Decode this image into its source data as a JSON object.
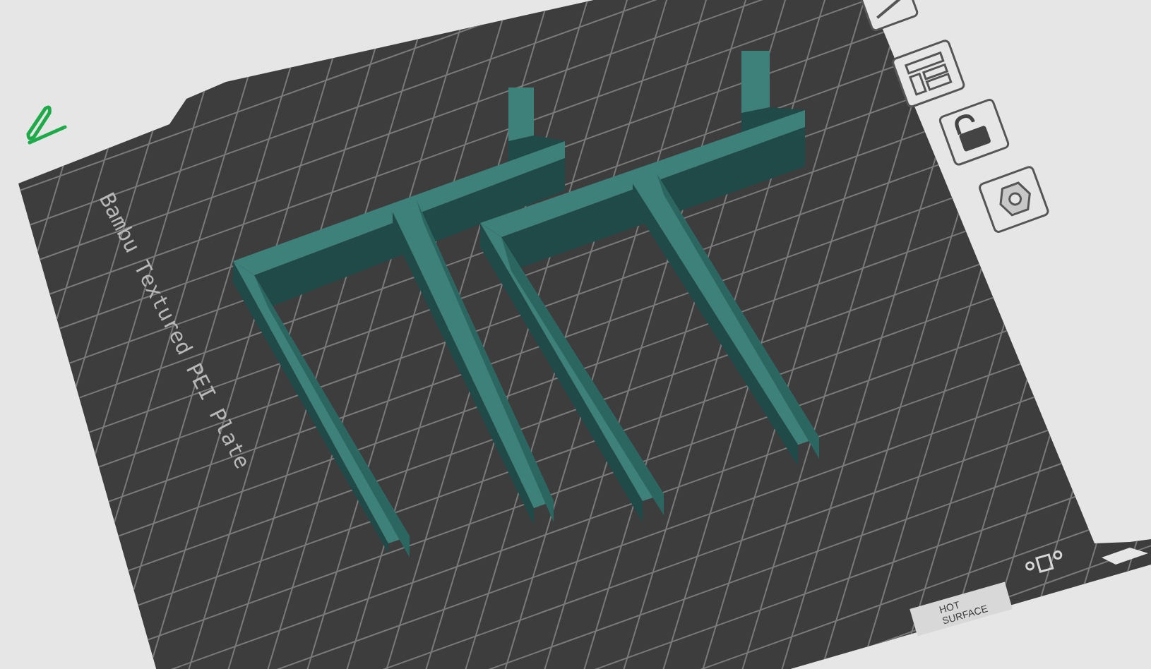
{
  "plate": {
    "label": "Bambu Textured PEI Plate",
    "warning": "HOT SURFACE"
  }
}
